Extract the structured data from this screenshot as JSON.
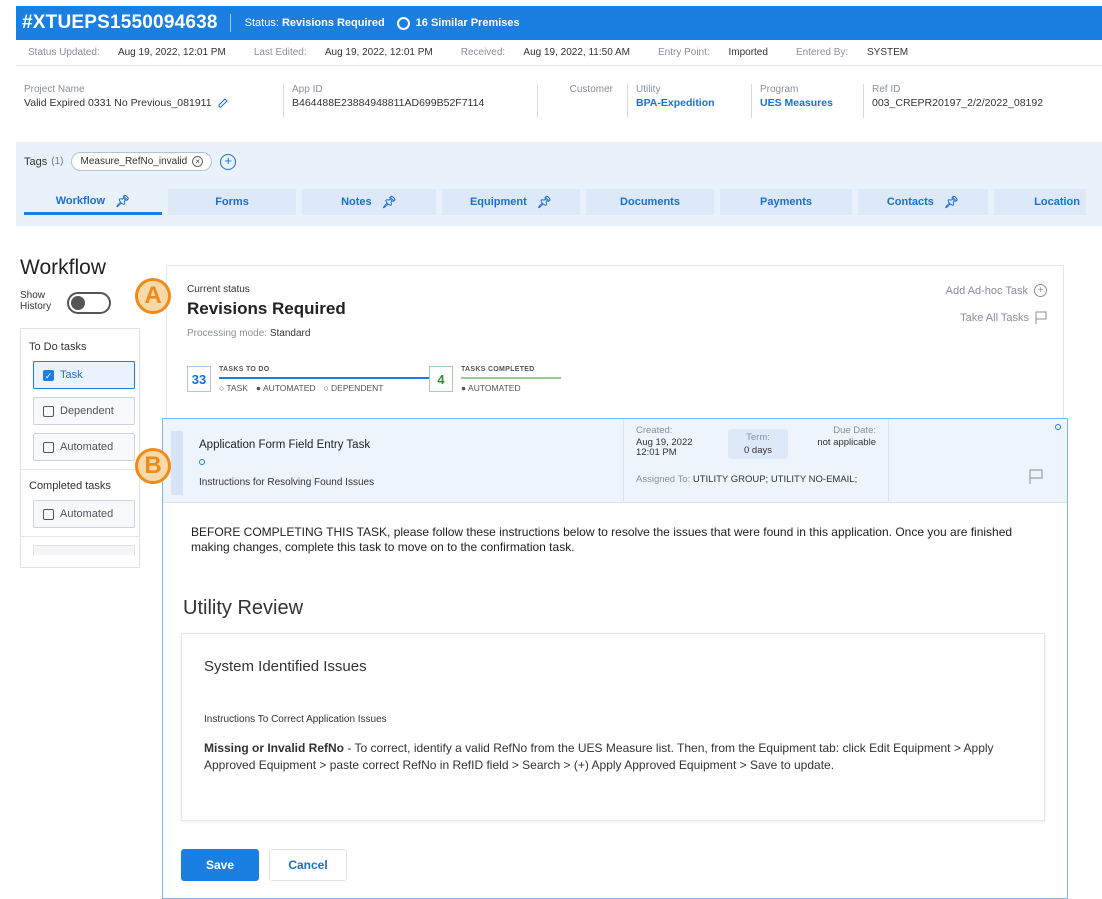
{
  "header": {
    "app_id": "#XTUEPS1550094638",
    "status_prefix": "Status:",
    "status_value": "Revisions Required",
    "similar": "16 Similar Premises"
  },
  "meta": {
    "status_updated_label": "Status Updated:",
    "status_updated_value": "Aug 19, 2022, 12:01 PM",
    "last_edited_label": "Last Edited:",
    "last_edited_value": "Aug 19, 2022, 12:01 PM",
    "received_label": "Received:",
    "received_value": "Aug 19, 2022, 11:50 AM",
    "entry_point_label": "Entry Point:",
    "entry_point_value": "Imported",
    "entered_by_label": "Entered By:",
    "entered_by_value": "SYSTEM"
  },
  "info": [
    {
      "label": "Project Name",
      "value": "Valid Expired 0331 No Previous_081911"
    },
    {
      "label": "App ID",
      "value": "B464488E23884948811AD699B52F7114"
    },
    {
      "label": "Customer",
      "value": ""
    },
    {
      "label": "Utility",
      "value": "BPA-Expedition"
    },
    {
      "label": "Program",
      "value": "UES Measures"
    },
    {
      "label": "Ref ID",
      "value": "003_CREPR20197_2/2/2022_08192"
    }
  ],
  "tags": {
    "label": "Tags",
    "count": "(1)",
    "items": [
      "Measure_RefNo_invalid"
    ]
  },
  "tabs": [
    {
      "label": "Workflow"
    },
    {
      "label": "Forms"
    },
    {
      "label": "Notes"
    },
    {
      "label": "Equipment"
    },
    {
      "label": "Documents"
    },
    {
      "label": "Payments"
    },
    {
      "label": "Contacts"
    },
    {
      "label": "Location"
    }
  ],
  "workflow": {
    "title": "Workflow",
    "show_history": "Show History",
    "todo_label": "To Do tasks",
    "todo_filters": [
      "Task",
      "Dependent",
      "Automated"
    ],
    "completed_label": "Completed tasks",
    "completed_filters": [
      "Automated"
    ]
  },
  "status_card": {
    "current_status_label": "Current status",
    "current_status": "Revisions Required",
    "processing_mode_label": "Processing mode:",
    "processing_mode_value": "Standard",
    "add_adhoc": "Add Ad-hoc Task",
    "take_all": "Take All Tasks",
    "todo_count": "33",
    "todo_caption": "TASKS TO DO",
    "todo_legend": [
      "TASK",
      "AUTOMATED",
      "DEPENDENT"
    ],
    "completed_count": "4",
    "completed_caption": "TASKS COMPLETED",
    "completed_legend": [
      "AUTOMATED"
    ]
  },
  "task": {
    "title": "Application Form Field Entry Task",
    "subtitle": "Instructions for Resolving Found Issues",
    "created_label": "Created:",
    "created_value": "Aug 19, 2022 12:01 PM",
    "term_label": "Term:",
    "term_value": "0 days",
    "due_label": "Due Date:",
    "due_value": "not applicable",
    "assigned_label": "Assigned To:",
    "assigned_value": "UTILITY GROUP; UTILITY NO-EMAIL;",
    "instructions": "BEFORE COMPLETING THIS TASK, please follow these instructions below to resolve the issues that were found in this application. Once you are finished making changes, complete this task to move on to the confirmation task.",
    "section_title": "Utility Review",
    "issues_title": "System Identified Issues",
    "issues_sub": "Instructions To Correct Application Issues",
    "issue_bold": "Missing or Invalid RefNo",
    "issue_text": " - To correct, identify a valid RefNo from the UES Measure list. Then, from the Equipment tab: click Edit Equipment > Apply Approved Equipment > paste correct RefNo in RefID field > Search > (+) Apply Approved Equipment > Save to update.",
    "save_label": "Save",
    "cancel_label": "Cancel"
  },
  "callouts": {
    "a": "A",
    "b": "B"
  },
  "colors": {
    "brand_blue": "#1a7fe0",
    "callout_orange": "#f08a1a"
  }
}
